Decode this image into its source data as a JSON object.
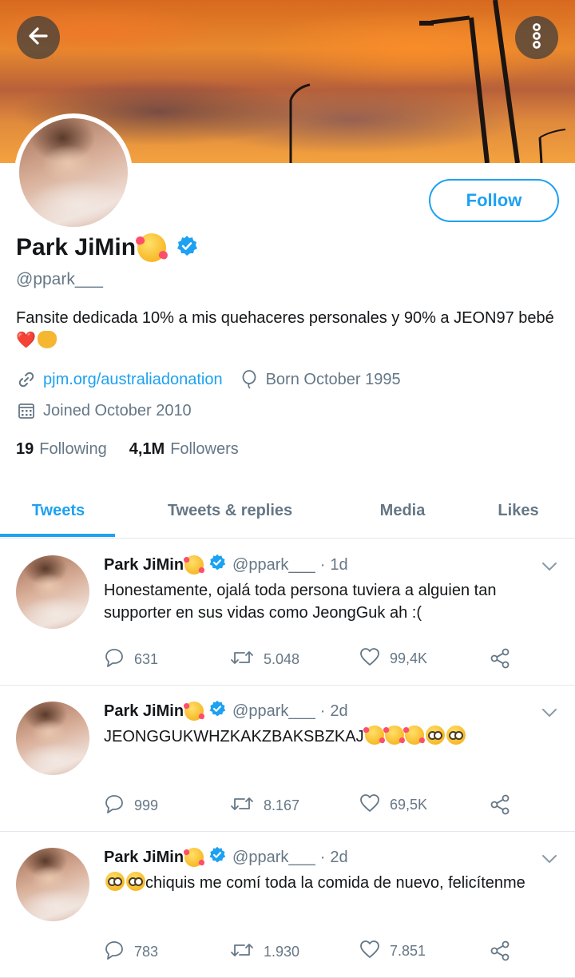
{
  "profile": {
    "display_name": "Park JiMin",
    "handle": "@ppark___",
    "bio_text": "Fansite dedicada 10% a mis quehaceres personales y 90% a JEON97 bebé",
    "bio_heart": "❤️",
    "link": "pjm.org/australiadonation",
    "born": "Born October 1995",
    "joined": "Joined October 2010",
    "following_count": "19",
    "following_label": "Following",
    "followers_count": "4,1M",
    "followers_label": "Followers",
    "follow_label": "Follow"
  },
  "tabs": [
    {
      "label": "Tweets",
      "active": true
    },
    {
      "label": "Tweets & replies",
      "active": false
    },
    {
      "label": "Media",
      "active": false
    },
    {
      "label": "Likes",
      "active": false
    }
  ],
  "tweets": [
    {
      "name": "Park JiMin",
      "handle": "@ppark___",
      "sep": "·",
      "time": "1d",
      "text": "Honestamente, ojalá toda persona tuviera a alguien tan supporter en sus vidas como JeongGuk ah :(",
      "replies": "631",
      "retweets": "5.048",
      "likes": "99,4K"
    },
    {
      "name": "Park JiMin",
      "handle": "@ppark___",
      "sep": "·",
      "time": "2d",
      "text": "JEONGGUKWHZKAKZBAKSBZKAJ",
      "replies": "999",
      "retweets": "8.167",
      "likes": "69,5K"
    },
    {
      "name": "Park JiMin",
      "handle": "@ppark___",
      "sep": "·",
      "time": "2d",
      "text": "chiquis me comí toda la comida de nuevo, felicítenme",
      "replies": "783",
      "retweets": "1.930",
      "likes": "7.851"
    }
  ],
  "colors": {
    "accent": "#1da1f2",
    "muted": "#657786",
    "text": "#14171a"
  },
  "icons": [
    "back-arrow-icon",
    "more-vertical-icon",
    "verified-icon",
    "link-icon",
    "balloon-icon",
    "calendar-icon",
    "chevron-down-icon",
    "reply-icon",
    "retweet-icon",
    "like-icon",
    "share-icon"
  ]
}
